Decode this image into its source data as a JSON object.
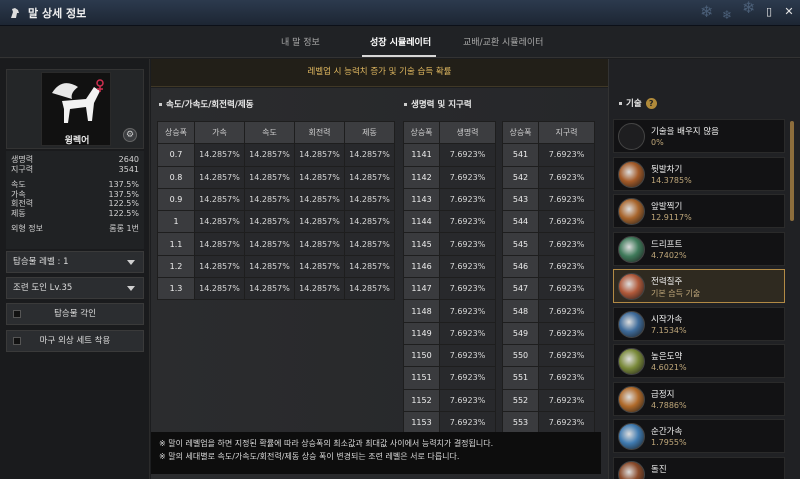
{
  "window": {
    "title": "말 상세 정보"
  },
  "tabs": [
    {
      "label": "내 말 정보"
    },
    {
      "label": "성장 시뮬레이터"
    },
    {
      "label": "교배/교환 시뮬레이터"
    }
  ],
  "horse": {
    "name": "윙렉어",
    "stats": [
      {
        "label": "생명력",
        "value": "2640"
      },
      {
        "label": "지구력",
        "value": "3541"
      },
      {
        "label": "속도",
        "value": "137.5%"
      },
      {
        "label": "가속",
        "value": "137.5%"
      },
      {
        "label": "회전력",
        "value": "122.5%"
      },
      {
        "label": "제동",
        "value": "122.5%"
      }
    ],
    "appearance": {
      "label": "외형 정보",
      "value": "롬롱 1번"
    }
  },
  "controls": {
    "level_dropdown": "탑승물 레벨 : 1",
    "trainer_dropdown": "조련 도인 Lv.35",
    "engrave_option": "탑승물 각인",
    "outfit_option": "마구 외상 세트 착용"
  },
  "banner": "레벨업 시 능력치 증가 및 기술 습득 확률",
  "speed_table": {
    "title": "속도/가속도/회전력/제동",
    "headers": [
      "상승폭",
      "가속",
      "속도",
      "회전력",
      "제동"
    ],
    "rows": [
      [
        "0.7",
        "14.2857%",
        "14.2857%",
        "14.2857%",
        "14.2857%"
      ],
      [
        "0.8",
        "14.2857%",
        "14.2857%",
        "14.2857%",
        "14.2857%"
      ],
      [
        "0.9",
        "14.2857%",
        "14.2857%",
        "14.2857%",
        "14.2857%"
      ],
      [
        "1",
        "14.2857%",
        "14.2857%",
        "14.2857%",
        "14.2857%"
      ],
      [
        "1.1",
        "14.2857%",
        "14.2857%",
        "14.2857%",
        "14.2857%"
      ],
      [
        "1.2",
        "14.2857%",
        "14.2857%",
        "14.2857%",
        "14.2857%"
      ],
      [
        "1.3",
        "14.2857%",
        "14.2857%",
        "14.2857%",
        "14.2857%"
      ]
    ]
  },
  "hp_table": {
    "title": "생명력 및 지구력",
    "hp_headers": [
      "상승폭",
      "생명력"
    ],
    "st_headers": [
      "상승폭",
      "지구력"
    ],
    "hp_rows": [
      [
        "1141",
        "7.6923%"
      ],
      [
        "1142",
        "7.6923%"
      ],
      [
        "1143",
        "7.6923%"
      ],
      [
        "1144",
        "7.6923%"
      ],
      [
        "1145",
        "7.6923%"
      ],
      [
        "1146",
        "7.6923%"
      ],
      [
        "1147",
        "7.6923%"
      ],
      [
        "1148",
        "7.6923%"
      ],
      [
        "1149",
        "7.6923%"
      ],
      [
        "1150",
        "7.6923%"
      ],
      [
        "1151",
        "7.6923%"
      ],
      [
        "1152",
        "7.6923%"
      ],
      [
        "1153",
        "7.6923%"
      ]
    ],
    "st_rows": [
      [
        "541",
        "7.6923%"
      ],
      [
        "542",
        "7.6923%"
      ],
      [
        "543",
        "7.6923%"
      ],
      [
        "544",
        "7.6923%"
      ],
      [
        "545",
        "7.6923%"
      ],
      [
        "546",
        "7.6923%"
      ],
      [
        "547",
        "7.6923%"
      ],
      [
        "548",
        "7.6923%"
      ],
      [
        "549",
        "7.6923%"
      ],
      [
        "550",
        "7.6923%"
      ],
      [
        "551",
        "7.6923%"
      ],
      [
        "552",
        "7.6923%"
      ],
      [
        "553",
        "7.6923%"
      ]
    ]
  },
  "notes": [
    "※ 말이 레벨업을 하면 지정된 확률에 따라 상승폭의 최소값과 최대값 사이에서 능력치가 결정됩니다.",
    "※ 말의 세대별로 속도/가속도/회전력/제동 상승 폭이 변경되는 조련 레벨은 서로 다릅니다."
  ],
  "skills": {
    "title": "기술",
    "help_icon": "?",
    "items": [
      {
        "name": "기술을 배우지 않음",
        "rate": "0%",
        "color": "#222222"
      },
      {
        "name": "뒷발차기",
        "rate": "14.3785%",
        "color": "#a35a28"
      },
      {
        "name": "앞발찍기",
        "rate": "12.9117%",
        "color": "#a8652c"
      },
      {
        "name": "드리프트",
        "rate": "4.7402%",
        "color": "#3f7a5a"
      },
      {
        "name": "전력질주",
        "rate": "기본 습득 기술",
        "color": "#b0593a"
      },
      {
        "name": "시작가속",
        "rate": "7.1534%",
        "color": "#3e6b9a"
      },
      {
        "name": "높은도약",
        "rate": "4.6021%",
        "color": "#7a8a3a"
      },
      {
        "name": "급정지",
        "rate": "4.7886%",
        "color": "#b06a2a"
      },
      {
        "name": "순간가속",
        "rate": "1.7955%",
        "color": "#3f7ab0"
      },
      {
        "name": "돌진",
        "rate": "",
        "color": "#8a4a2a"
      }
    ]
  }
}
